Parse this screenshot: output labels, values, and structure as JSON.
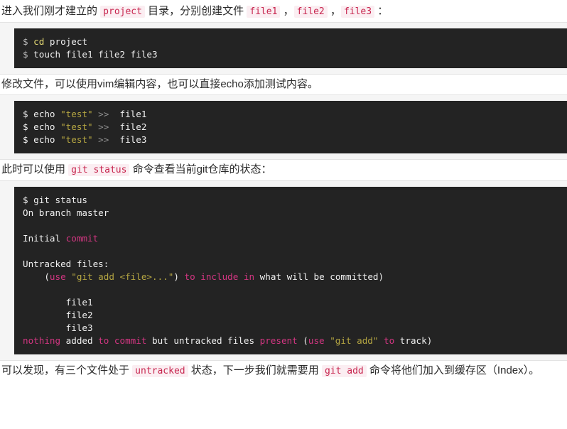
{
  "document": {
    "language": "zh-CN",
    "theme": {
      "page_background": "#ffffff",
      "code_wrapper_background": "#f5f5f5",
      "code_wrapper_border": "#e3e3e3",
      "code_background": "#232323",
      "code_foreground": "#f0f0f0",
      "inline_code_color": "#c7254e",
      "inline_code_background": "#fbeef2",
      "token_string": "#b5a642",
      "token_keyword": "#e6db74",
      "token_pink": "#d33682",
      "token_operator": "#8f8f8f"
    },
    "paragraphs": {
      "p1": {
        "seg1": "进入我们刚才建立的 ",
        "code1": "project",
        "seg2": " 目录，分别创建文件 ",
        "code2": "file1",
        "seg3": " ，",
        "code3": "file2",
        "seg4": " ，",
        "code4": "file3",
        "seg5": " ："
      },
      "p2": {
        "text": "修改文件，可以使用vim编辑内容，也可以直接echo添加测试内容。"
      },
      "p3": {
        "seg1": "此时可以使用 ",
        "code1": "git status",
        "seg2": " 命令查看当前git仓库的状态："
      },
      "p4": {
        "seg1": "可以发现，有三个文件处于 ",
        "code1": "untracked",
        "seg2": " 状态，下一步我们就需要用 ",
        "code2": "git add",
        "seg3": " 命令将他们加入到缓存区（Index）。"
      }
    },
    "code_blocks": [
      {
        "id": "block-create-files",
        "lines": [
          {
            "prompt": "$ ",
            "kw": "cd",
            "rest": " project"
          },
          {
            "prompt": "$ ",
            "kw": "",
            "rest": "touch file1 file2 file3"
          }
        ],
        "plain_text": "$ cd project\n$ touch file1 file2 file3"
      },
      {
        "id": "block-echo-test",
        "lines": [
          {
            "prompt": "$ ",
            "cmd": "echo ",
            "str": "\"test\"",
            "op": " >> ",
            "arg": " file1"
          },
          {
            "prompt": "$ ",
            "cmd": "echo ",
            "str": "\"test\"",
            "op": " >> ",
            "arg": " file2"
          },
          {
            "prompt": "$ ",
            "cmd": "echo ",
            "str": "\"test\"",
            "op": " >> ",
            "arg": " file3"
          }
        ],
        "plain_text": "$ echo \"test\" >> file1\n$ echo \"test\" >> file2\n$ echo \"test\" >> file3"
      },
      {
        "id": "block-git-status",
        "plain_text": "$ git status\nOn branch master\n\nInitial commit\n\nUntracked files:\n    (use \"git add <file>...\") to include in what will be committed)\n\n        file1\n        file2\n        file3\nnothing added to commit but untracked files present (use \"git add\" to track)",
        "parts": {
          "l1": "$ git status",
          "l2": "On branch master",
          "l3_pre": "Initial ",
          "l3_pink": "commit",
          "l4": "Untracked files:",
          "l5_indent": "    (",
          "l5_use": "use",
          "l5_str": " \"git add <file>...\"",
          "l5_close": ") ",
          "l5_pink2": "to include",
          "l5_mid": " ",
          "l5_in": "in",
          "l5_tail": " what will be committed)",
          "f1": "        file1",
          "f2": "        file2",
          "f3": "        file3",
          "l9_nothing": "nothing",
          "l9_added": " added ",
          "l9_tocommit": "to commit",
          "l9_but": " but untracked files ",
          "l9_present": "present",
          "l9_paren": " (",
          "l9_use": "use",
          "l9_str": " \"git add\" ",
          "l9_to": "to",
          "l9_track": " track)"
        }
      }
    ]
  }
}
